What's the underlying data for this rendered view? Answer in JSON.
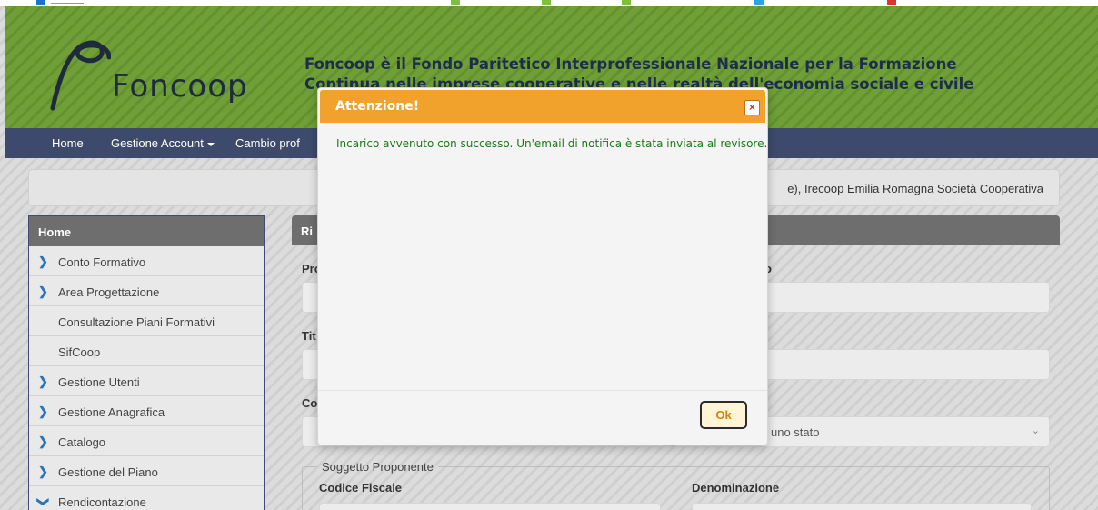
{
  "header": {
    "logo_text": "Foncoop",
    "tagline_line1": "Foncoop è il Fondo Paritetico Interprofessionale Nazionale per la Formazione",
    "tagline_line2": "Continua nelle imprese cooperative e nelle realtà dell'economia sociale e civile"
  },
  "nav": {
    "items": [
      "Home",
      "Gestione Account",
      "Cambio prof"
    ]
  },
  "user_bar": {
    "text": "e), Irecoop Emilia Romagna Società Cooperativa"
  },
  "sidebar": {
    "header": "Home",
    "items": [
      {
        "label": "Conto Formativo",
        "icon": "chevron-right-icon"
      },
      {
        "label": "Area Progettazione",
        "icon": "chevron-right-icon"
      },
      {
        "label": "Consultazione Piani Formativi",
        "icon": ""
      },
      {
        "label": "SifCoop",
        "icon": ""
      },
      {
        "label": "Gestione Utenti",
        "icon": "chevron-right-icon"
      },
      {
        "label": "Gestione Anagrafica",
        "icon": "chevron-right-icon"
      },
      {
        "label": "Catalogo",
        "icon": "chevron-right-icon"
      },
      {
        "label": "Gestione del Piano",
        "icon": "chevron-right-icon"
      },
      {
        "label": "Rendicontazione",
        "icon": "chevron-down-icon"
      }
    ]
  },
  "main": {
    "panel_title": "Ri",
    "labels": {
      "left1": "Pro",
      "left2": "Tit",
      "left3": "Co",
      "right1": "o"
    },
    "select_placeholder": "uno stato",
    "fieldset_legend": "Soggetto Proponente",
    "codice_fiscale_label": "Codice Fiscale",
    "denominazione_label": "Denominazione"
  },
  "modal": {
    "title": "Attenzione!",
    "close_symbol": "×",
    "message": "Incarico avvenuto con successo. Un'email di notifica è stata inviata al revisore.",
    "ok_label": "Ok"
  },
  "colors": {
    "banner_green": "#6b9a33",
    "nav_blue": "#3e4a6c",
    "modal_orange": "#f0a22c",
    "message_green": "#1a7a1a"
  }
}
